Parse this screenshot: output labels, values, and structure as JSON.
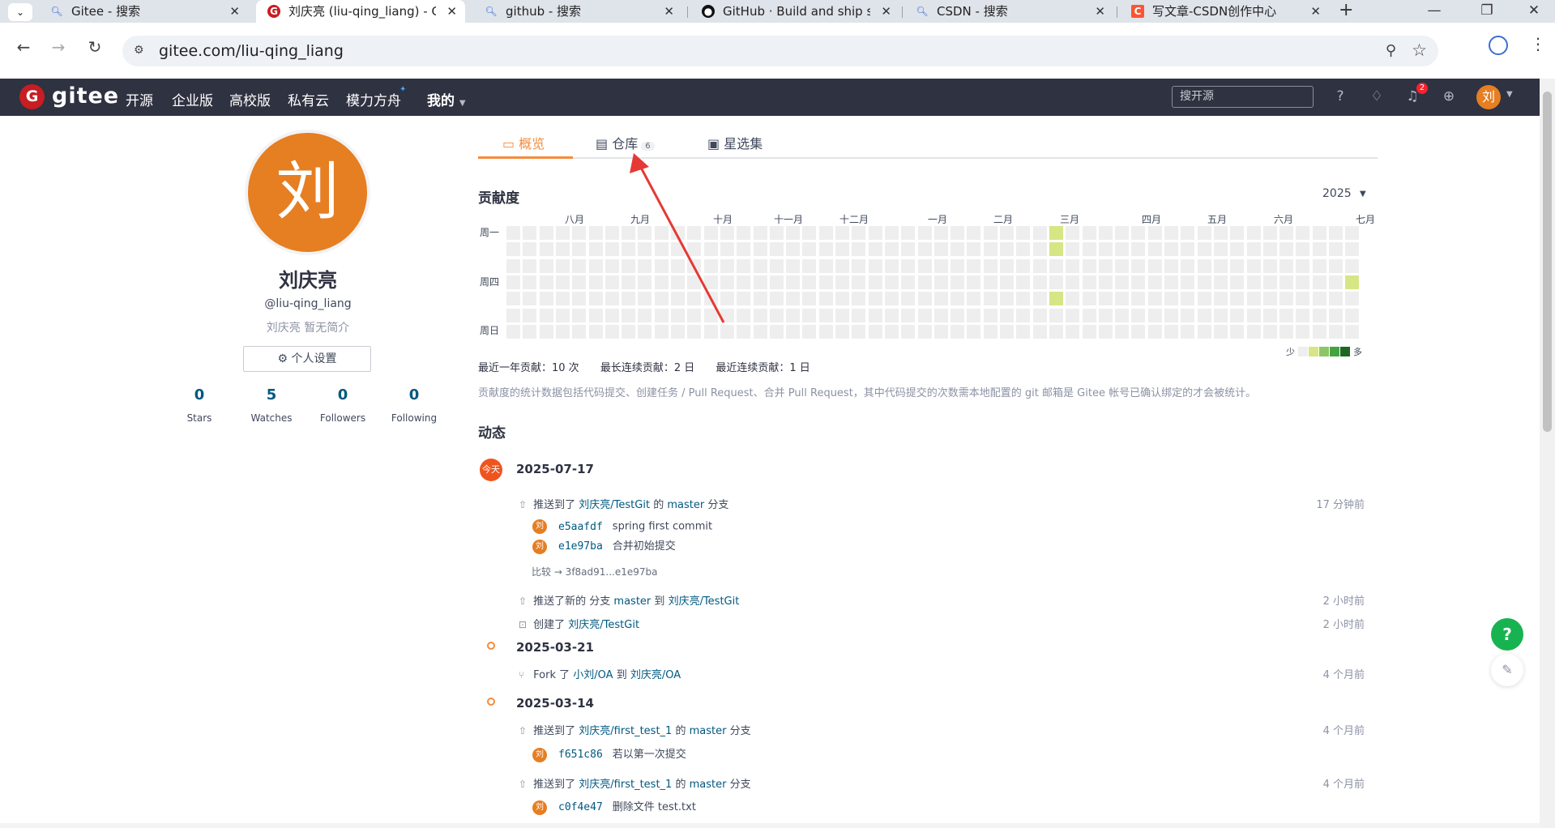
{
  "browser": {
    "tabs": [
      {
        "title": "Gitee - 搜索",
        "icon": "search-icon"
      },
      {
        "title": "刘庆亮 (liu-qing_liang) - Gitee",
        "icon": "gitee-icon"
      },
      {
        "title": "github - 搜索",
        "icon": "search-icon"
      },
      {
        "title": "GitHub · Build and ship software",
        "icon": "github-icon"
      },
      {
        "title": "CSDN - 搜索",
        "icon": "search-icon"
      },
      {
        "title": "写文章-CSDN创作中心",
        "icon": "csdn-icon"
      }
    ],
    "url": "gitee.com/liu-qing_liang"
  },
  "header": {
    "brand": "gitee",
    "nav": [
      "开源",
      "企业版",
      "高校版",
      "私有云",
      "模力方舟",
      "我的"
    ],
    "search_placeholder": "搜开源",
    "notification_count": "2",
    "avatar_text": "刘"
  },
  "profile": {
    "avatar_text": "刘",
    "name": "刘庆亮",
    "handle": "@liu-qing_liang",
    "bio": "刘庆亮 暂无简介",
    "settings_label": "个人设置",
    "stats": [
      {
        "value": "0",
        "label": "Stars"
      },
      {
        "value": "5",
        "label": "Watches"
      },
      {
        "value": "0",
        "label": "Followers"
      },
      {
        "value": "0",
        "label": "Following"
      }
    ]
  },
  "tabs": {
    "overview": "概览",
    "repos": "仓库",
    "repos_count": "6",
    "stars": "星选集"
  },
  "contribution": {
    "title": "贡献度",
    "year": "2025",
    "months": [
      "八月",
      "九月",
      "十月",
      "十一月",
      "十二月",
      "一月",
      "二月",
      "三月",
      "四月",
      "五月",
      "六月",
      "七月"
    ],
    "days": [
      "周一",
      "周四",
      "周日"
    ],
    "stats": {
      "yearly": "最近一年贡献：10 次",
      "longest": "最长连续贡献：2 日",
      "recent": "最近连续贡献：1 日"
    },
    "legend_less": "少",
    "legend_more": "多",
    "legend_colors": [
      "#eeeeee",
      "#d6e685",
      "#8cc665",
      "#44a340",
      "#1e6823"
    ],
    "note": "贡献度的统计数据包括代码提交、创建任务 / Pull Request、合并 Pull Request，其中代码提交的次数需本地配置的 git 邮箱是 Gitee 帐号已确认绑定的才会被统计。"
  },
  "activity": {
    "title": "动态",
    "today_badge": "今天",
    "compare_text": "比较 → 3f8ad91...e1e97ba",
    "groups": [
      {
        "date": "2025-07-17"
      },
      {
        "date": "2025-03-21"
      },
      {
        "date": "2025-03-14"
      }
    ],
    "events": [
      {
        "pre": "推送到了",
        "link1": "刘庆亮/TestGit",
        "mid": "的",
        "link2": "master",
        "post": "分支",
        "time": "17 分钟前"
      },
      {
        "pre": "推送了新的 分支",
        "link1": "master",
        "mid": "到",
        "link2": "刘庆亮/TestGit",
        "post": "",
        "time": "2 小时前"
      },
      {
        "pre": "创建了",
        "link1": "刘庆亮/TestGit",
        "mid": "",
        "link2": "",
        "post": "",
        "time": "2 小时前"
      },
      {
        "pre": "Fork 了",
        "link1": "小刘/OA",
        "mid": "到",
        "link2": "刘庆亮/OA",
        "post": "",
        "time": "4 个月前"
      },
      {
        "pre": "推送到了",
        "link1": "刘庆亮/first_test_1",
        "mid": "的",
        "link2": "master",
        "post": "分支",
        "time": "4 个月前"
      },
      {
        "pre": "推送到了",
        "link1": "刘庆亮/first_test_1",
        "mid": "的",
        "link2": "master",
        "post": "分支",
        "time": "4 个月前"
      }
    ],
    "commits": [
      {
        "avatar": "刘",
        "sha": "e5aafdf",
        "msg": "spring first commit"
      },
      {
        "avatar": "刘",
        "sha": "e1e97ba",
        "msg": "合并初始提交"
      },
      {
        "avatar": "刘",
        "sha": "f651c86",
        "msg": "若以第一次提交"
      },
      {
        "avatar": "刘",
        "sha": "c0f4e47",
        "msg": "删除文件 test.txt"
      }
    ]
  },
  "floating": {
    "help": "?"
  }
}
